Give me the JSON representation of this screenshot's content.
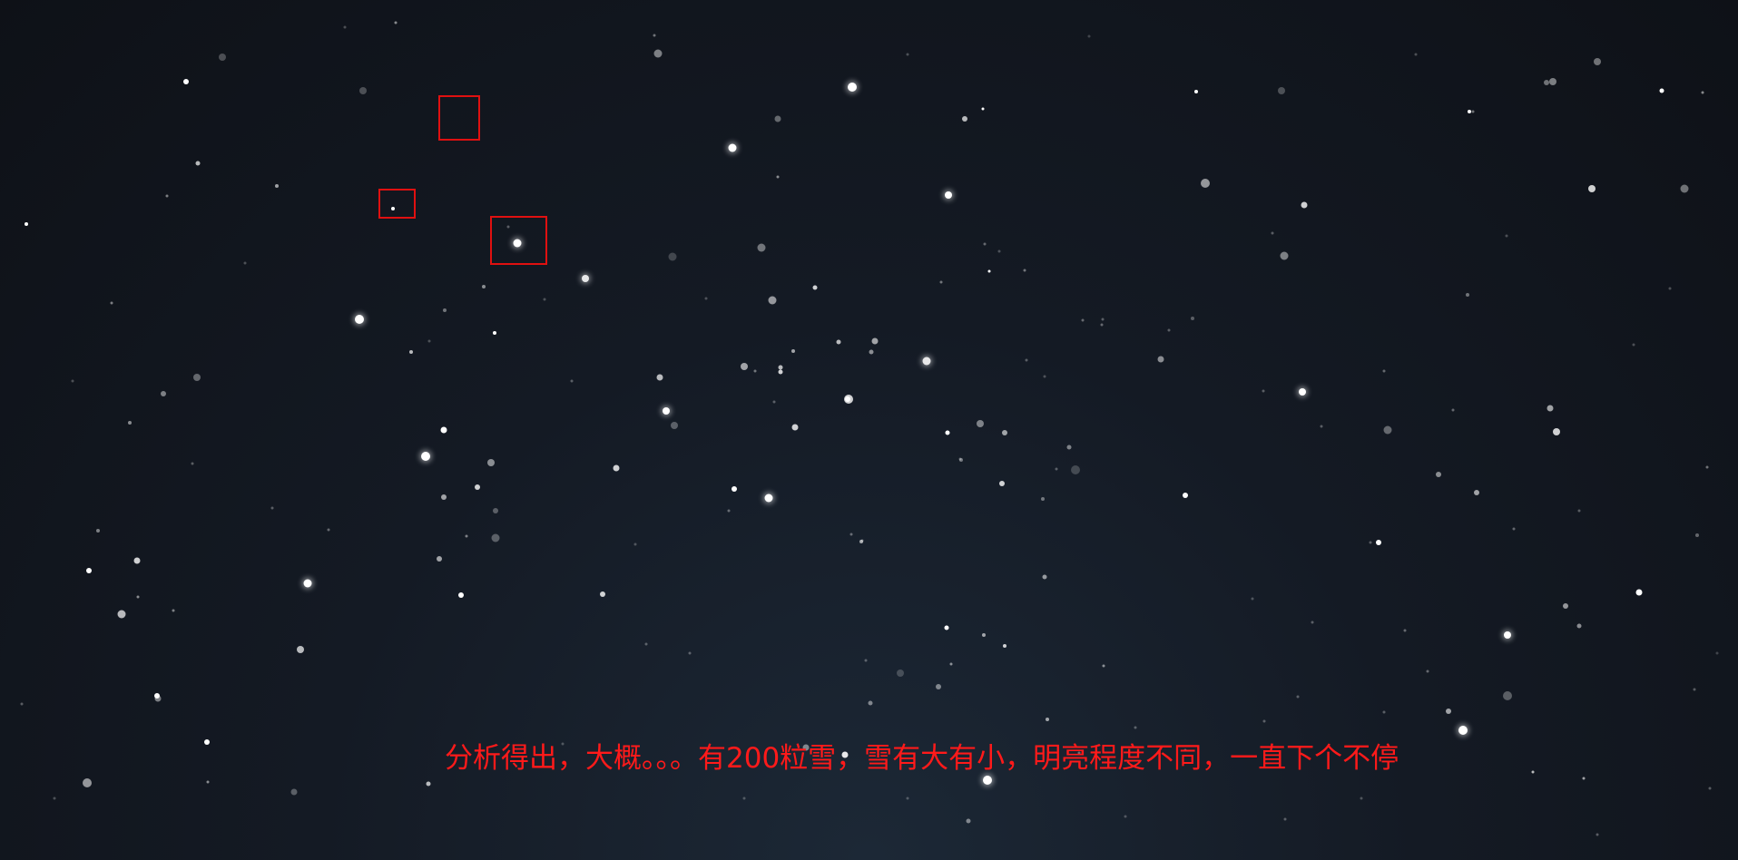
{
  "caption": "分析得出，大概。。。有200粒雪，雪有大有小，明亮程度不同，一直下个不停",
  "colors": {
    "background_top": "#0e1117",
    "background_bottom": "#1c2836",
    "snowflake": "#ffffff",
    "annotation_red": "#e01010"
  }
}
